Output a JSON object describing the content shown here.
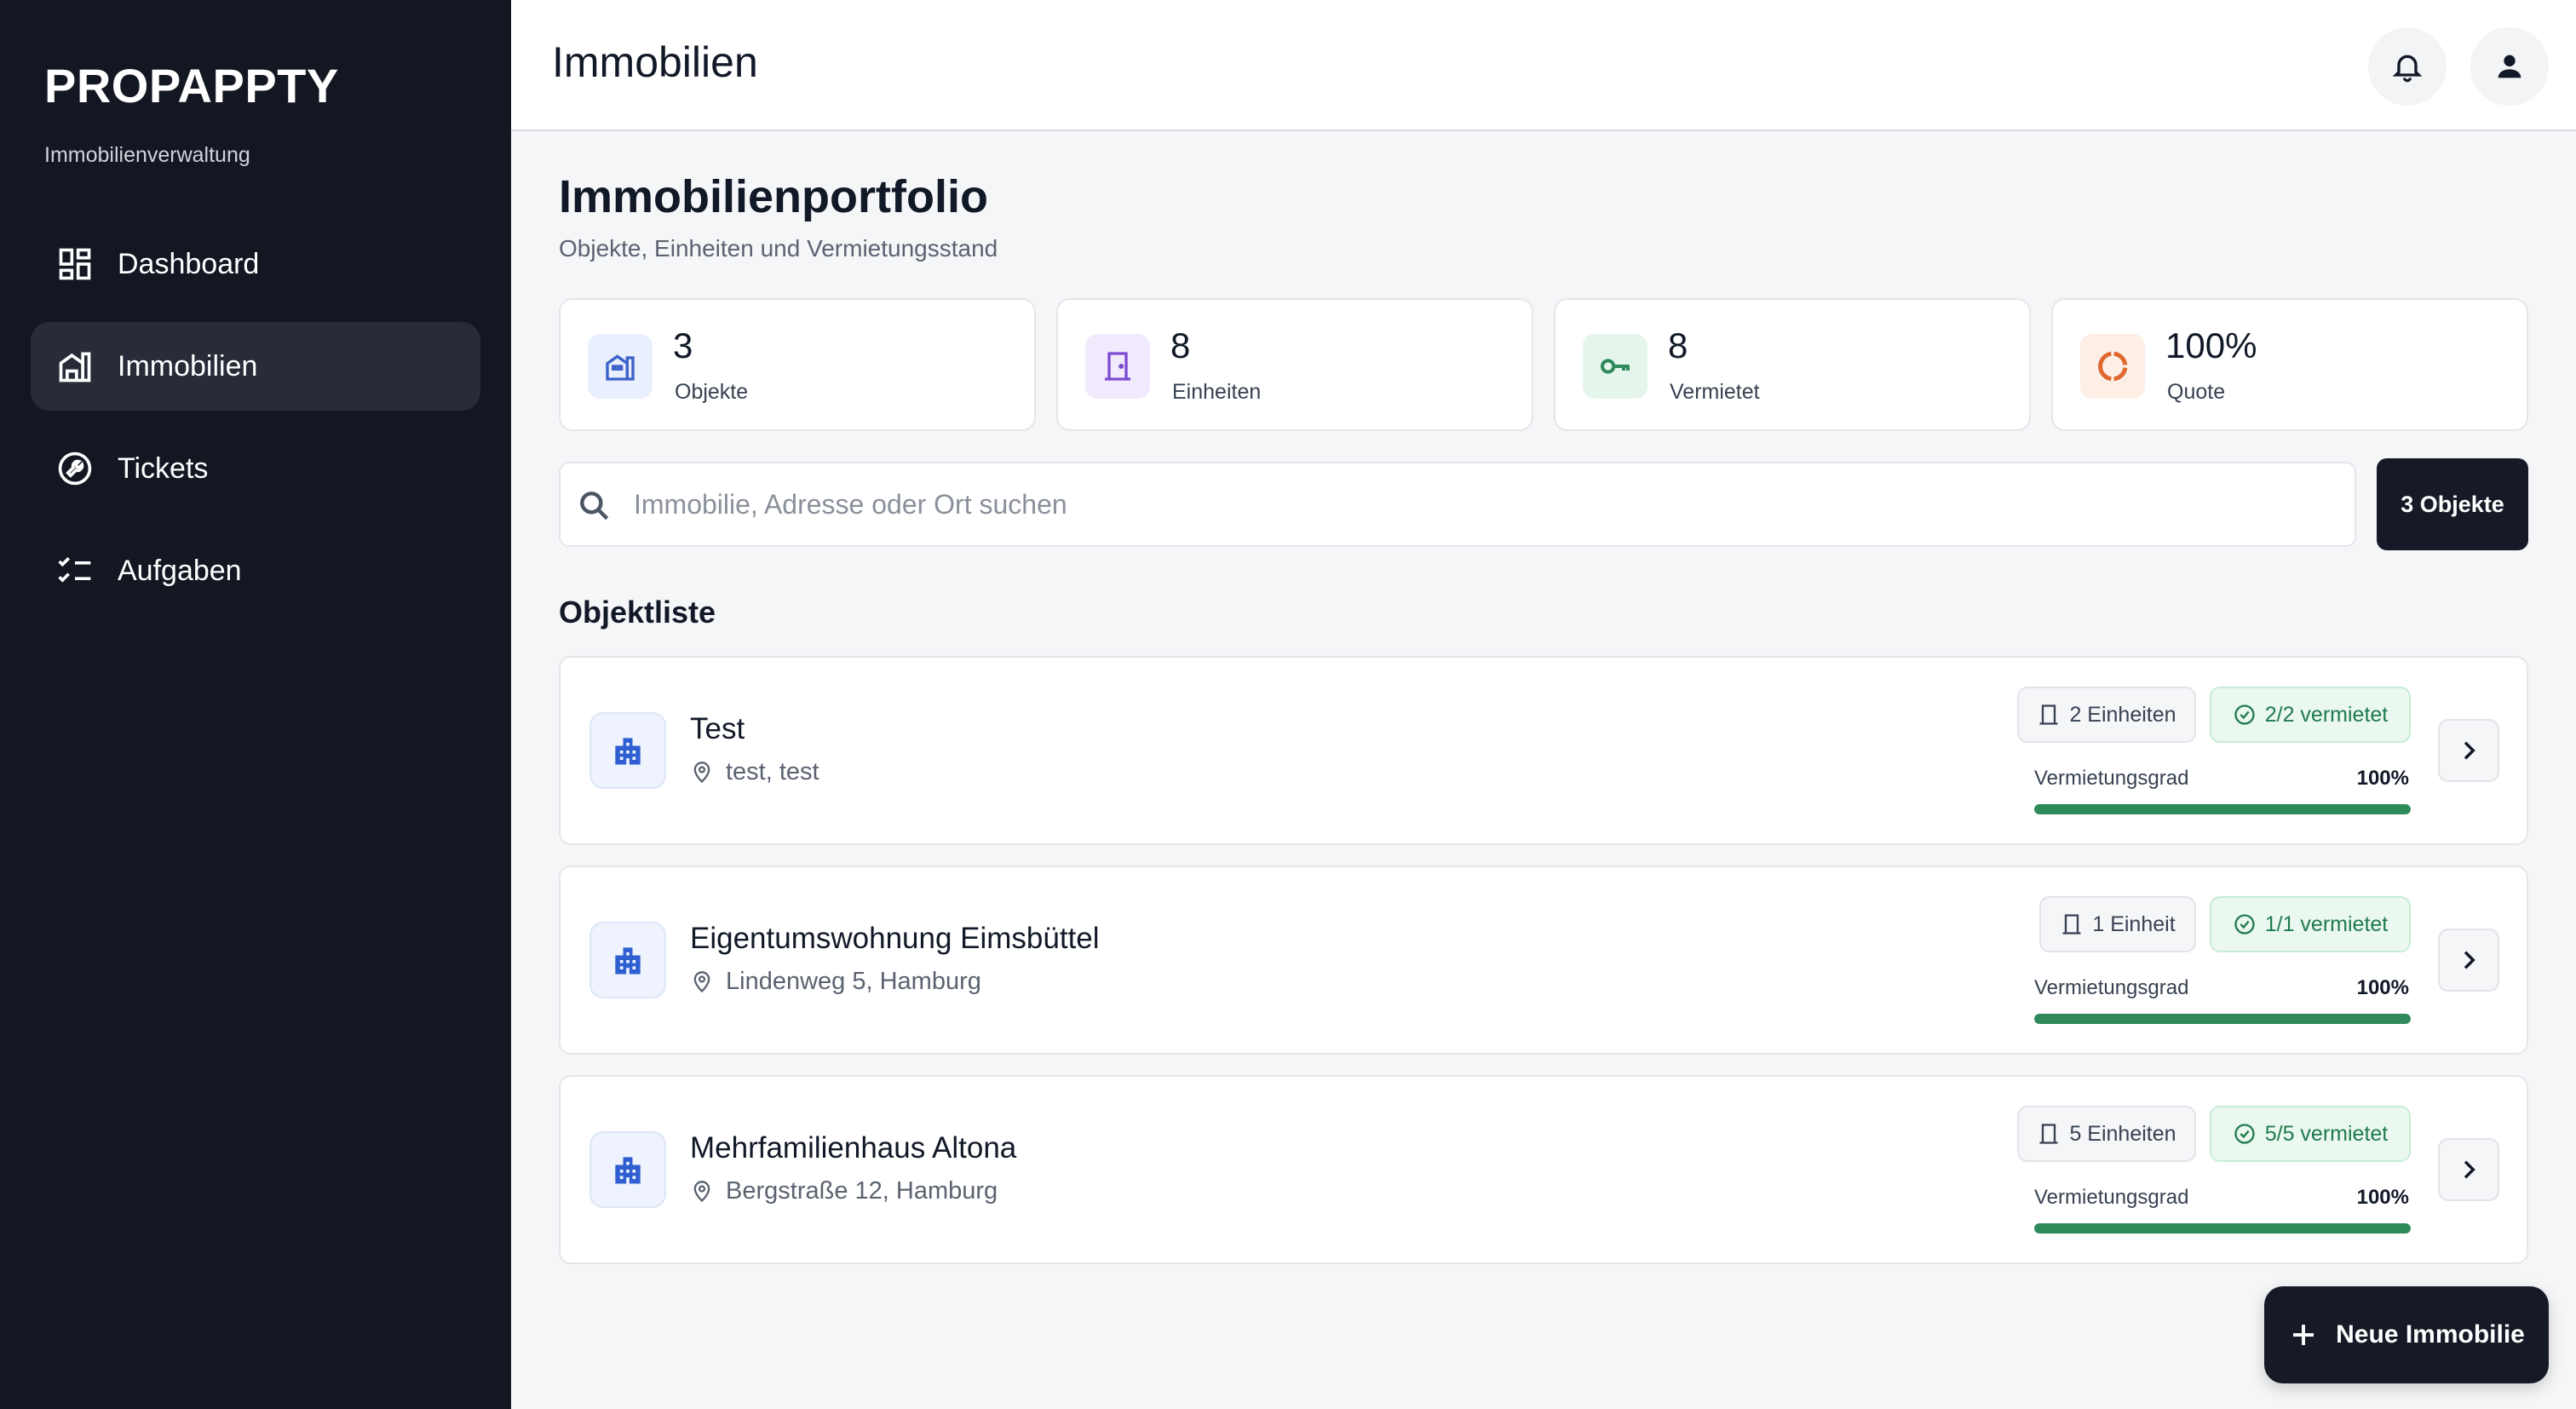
{
  "sidebar": {
    "brand": "PROPAPPTY",
    "subtitle": "Immobilienverwaltung",
    "items": [
      {
        "label": "Dashboard",
        "icon": "dashboard-icon",
        "active": false
      },
      {
        "label": "Immobilien",
        "icon": "building-icon",
        "active": true
      },
      {
        "label": "Tickets",
        "icon": "wrench-icon",
        "active": false
      },
      {
        "label": "Aufgaben",
        "icon": "checklist-icon",
        "active": false
      }
    ]
  },
  "header": {
    "title": "Immobilien",
    "notifications_icon": "bell-icon",
    "account_icon": "user-icon"
  },
  "main": {
    "title": "Immobilienportfolio",
    "subtitle": "Objekte, Einheiten und Vermietungsstand",
    "stats": [
      {
        "value": "3",
        "label": "Objekte",
        "icon": "building-icon",
        "color": "#3b63c9",
        "bg": "#e9effc"
      },
      {
        "value": "8",
        "label": "Einheiten",
        "icon": "door-icon",
        "color": "#7c4bd1",
        "bg": "#f0eafc"
      },
      {
        "value": "8",
        "label": "Vermietet",
        "icon": "key-icon",
        "color": "#2e8a5a",
        "bg": "#e6f5ec"
      },
      {
        "value": "100%",
        "label": "Quote",
        "icon": "donut-icon",
        "color": "#e0682f",
        "bg": "#fdeee6"
      }
    ],
    "search": {
      "placeholder": "Immobilie, Adresse oder Ort suchen",
      "value": ""
    },
    "count_button": "3 Objekte",
    "list_title": "Objektliste",
    "properties": [
      {
        "name": "Test",
        "address": "test, test",
        "units": "2 Einheiten",
        "rented": "2/2 vermietet",
        "occupancy_label": "Vermietungsgrad",
        "occupancy": "100%",
        "occupancy_fraction": 1.0
      },
      {
        "name": "Eigentumswohnung Eimsbüttel",
        "address": "Lindenweg 5, Hamburg",
        "units": "1 Einheit",
        "rented": "1/1 vermietet",
        "occupancy_label": "Vermietungsgrad",
        "occupancy": "100%",
        "occupancy_fraction": 1.0
      },
      {
        "name": "Mehrfamilienhaus Altona",
        "address": "Bergstraße 12, Hamburg",
        "units": "5 Einheiten",
        "rented": "5/5 vermietet",
        "occupancy_label": "Vermietungsgrad",
        "occupancy": "100%",
        "occupancy_fraction": 1.0
      }
    ],
    "fab_label": "Neue Immobilie"
  }
}
